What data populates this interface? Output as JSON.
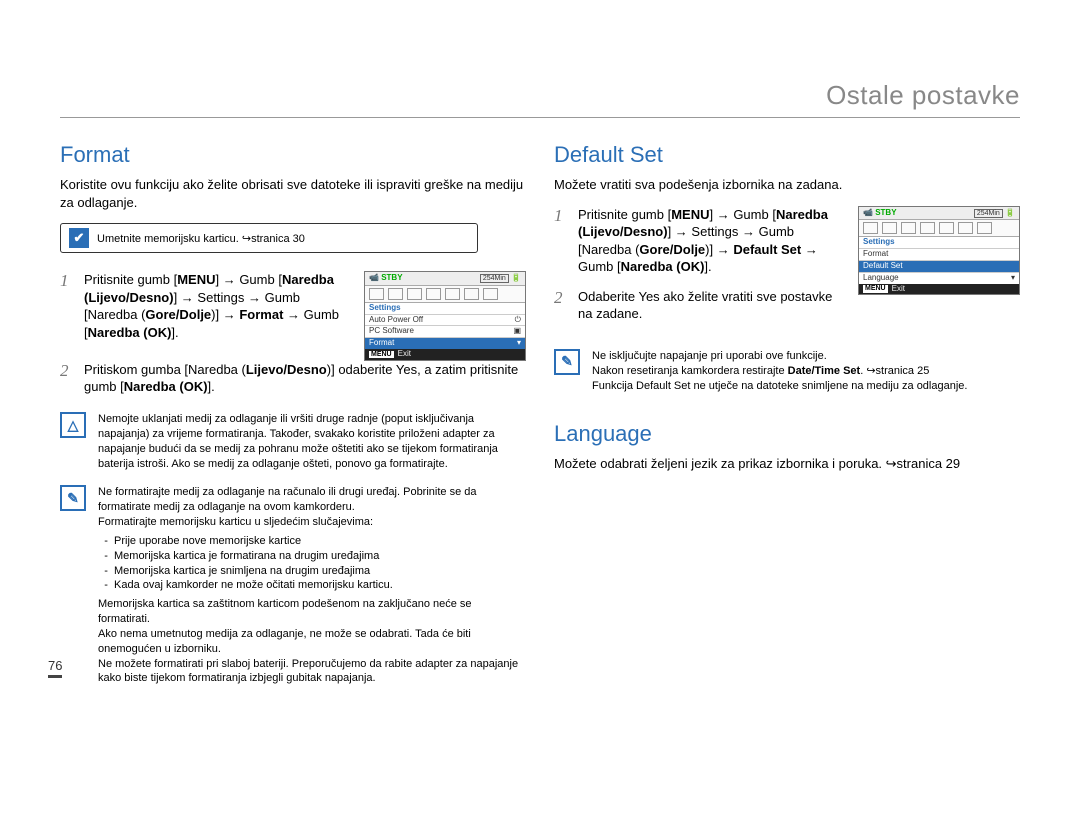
{
  "chapter_title": "Ostale postavke",
  "page_number": "76",
  "left": {
    "heading": "Format",
    "intro": "Koristite ovu funkciju ako želite obrisati sve datoteke ili ispraviti greške na mediju za odlaganje.",
    "precheck": "Umetnite memorijsku karticu. ↪stranica 30",
    "step1_lead": "Pritisnite gumb [",
    "menu_word": "MENU",
    "step1_part2": "] → Gumb [",
    "dir_lr": "Naredba (Lijevo/Desno)",
    "step1_part3": "] → Settings  → Gumb [Naredba (",
    "dir_ud": "Gore/Dolje",
    "step1_part4": ")] → ",
    "format_word": "Format",
    "step1_part5": " → Gumb [",
    "ok_word": "Naredba (OK)",
    "step1_end": "].",
    "step2_a": "Pritiskom gumba [Naredba (",
    "step2_b": "Lijevo/Desno",
    "step2_c": ")] odaberite Yes, a zatim pritisnite gumb [",
    "step2_ok": "Naredba (OK)",
    "step2_end": "].",
    "warn": "Nemojte uklanjati medij za odlaganje ili vršiti druge radnje (poput isključivanja napajanja) za vrijeme formatiranja. Također, svakako koristite priloženi adapter za napajanje budući da se medij za pohranu može oštetiti ako se tijekom formatiranja baterija istroši. Ako se medij za odlaganje ošteti, ponovo ga formatirajte.",
    "info1": "Ne formatirajte medij za odlaganje na računalo ili drugi uređaj. Pobrinite se da formatirate medij za odlaganje na ovom kamkorderu.",
    "info2": "Formatirajte memorijsku karticu u sljedećim slučajevima:",
    "bul1": "Prije uporabe nove memorijske kartice",
    "bul2": "Memorijska kartica je formatirana na drugim uređajima",
    "bul3": "Memorijska kartica je snimljena na drugim uređajima",
    "bul4": "Kada ovaj kamkorder ne može očitati memorijsku karticu.",
    "info3": "Memorijska kartica sa zaštitnom karticom podešenom na zaključano neće se formatirati.",
    "info4": "Ako nema umetnutog medija za odlaganje, ne može se odabrati. Tada će biti onemogućen u izborniku.",
    "info5": "Ne možete formatirati pri slaboj bateriji. Preporučujemo da rabite adapter za napajanje kako biste tijekom formatiranja izbjegli gubitak napajanja."
  },
  "right": {
    "heading_ds": "Default Set",
    "intro_ds": "Možete vratiti sva podešenja izbornika na zadana.",
    "ds_step1_a": "Pritisnite gumb [",
    "ds_step1_menu": "MENU",
    "ds_step1_b": "] → Gumb [",
    "ds_lr": "Naredba (Lijevo/Desno)",
    "ds_step1_c": "] → Settings  → Gumb [Naredba (",
    "ds_ud": "Gore/Dolje",
    "ds_step1_d": ")] → ",
    "ds_word": "Default Set",
    "ds_step1_e": " → Gumb [",
    "ds_ok": "Naredba (OK)",
    "ds_step1_end": "].",
    "ds_step2": "Odaberite Yes ako želite vratiti sve postavke na zadane.",
    "ds_info1": "Ne isključujte napajanje pri uporabi ove funkcije.",
    "ds_info2_a": "Nakon resetiranja kamkordera restirajte ",
    "ds_info2_b": "Date/Time Set",
    "ds_info2_c": ". ↪stranica 25",
    "ds_info3": "Funkcija Default Set ne utječe na datoteke snimljene na mediju za odlaganje.",
    "heading_lang": "Language",
    "lang_text": "Možete odabrati željeni jezik za prikaz izbornika i poruka. ↪stranica 29"
  },
  "lcd_common": {
    "stby": "STBY",
    "time": "254Min",
    "settings": "Settings",
    "exit": "Exit",
    "menu": "MENU"
  },
  "lcd_left": {
    "i1": "Auto Power Off",
    "i2": "PC Software",
    "i3": "Format"
  },
  "lcd_right": {
    "i1": "Format",
    "i2": "Default Set",
    "i3": "Language"
  }
}
